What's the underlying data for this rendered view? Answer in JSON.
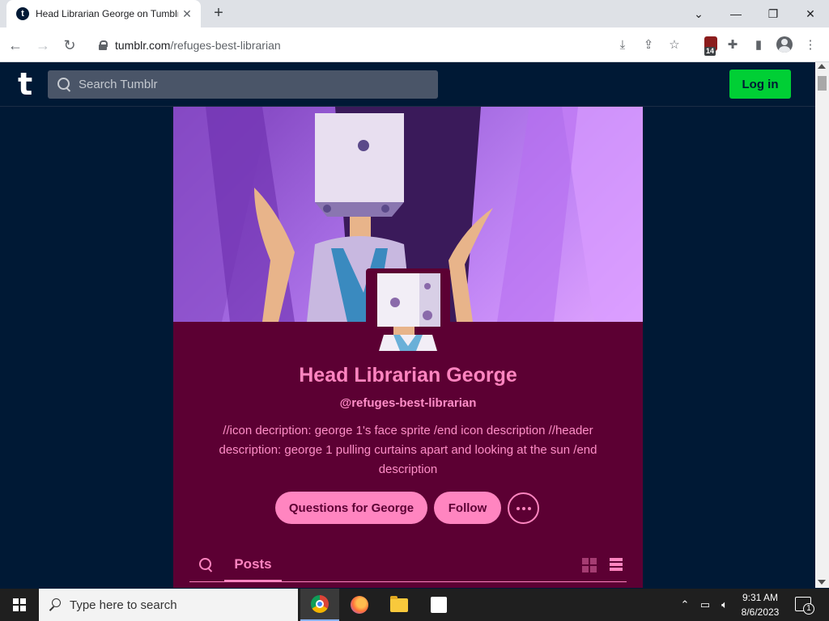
{
  "browser": {
    "tab_title": "Head Librarian George on Tumblr",
    "tab_favicon": "t",
    "url_domain": "tumblr.com",
    "url_path": "/refuges-best-librarian",
    "extension_badge_count": "14",
    "icons": [
      "back-icon",
      "forward-icon",
      "reload-icon",
      "lock-icon",
      "install-icon",
      "share-icon",
      "star-icon",
      "extension-icon",
      "puzzle-icon",
      "sidepanel-icon",
      "profile-icon",
      "menu-icon"
    ]
  },
  "tumblr": {
    "logo": "t",
    "search_placeholder": "Search Tumblr",
    "login_label": "Log in",
    "accent_color": "#00cf35"
  },
  "blog": {
    "title": "Head Librarian George",
    "handle": "@refuges-best-librarian",
    "description": "//icon decription: george 1's face sprite /end icon description //header description: george 1 pulling curtains apart and looking at the sun /end description",
    "buttons": {
      "ask": "Questions for George",
      "follow": "Follow"
    },
    "tabs": {
      "posts": "Posts"
    },
    "colors": {
      "background": "#5c0033",
      "accent": "#ff85c0"
    }
  },
  "taskbar": {
    "search_placeholder": "Type here to search",
    "apps": [
      "chrome-icon",
      "firefox-icon",
      "file-explorer-icon",
      "store-icon"
    ],
    "time": "9:31 AM",
    "date": "8/6/2023",
    "notification_count": "1"
  }
}
